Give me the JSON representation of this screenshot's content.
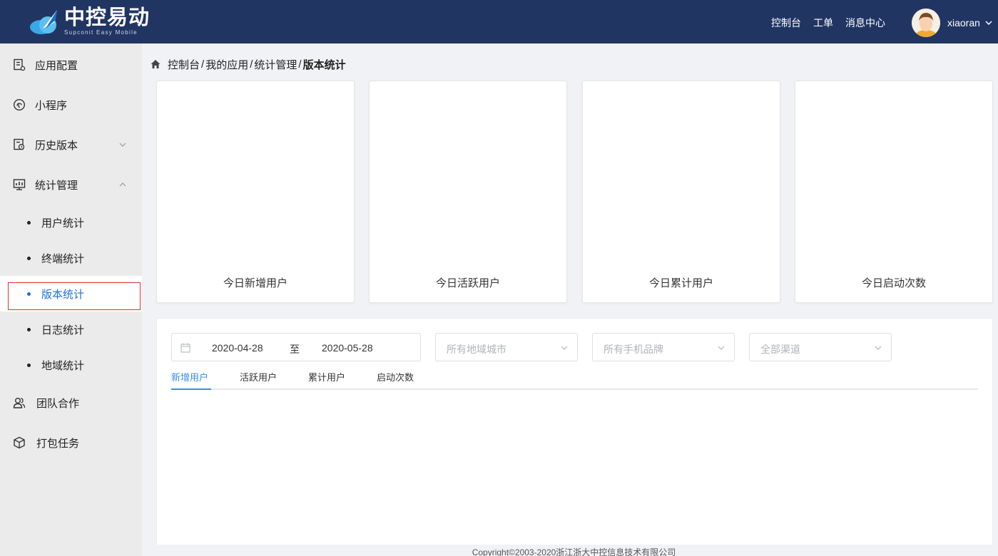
{
  "header": {
    "brand_title": "中控易动",
    "brand_subtitle": "Supconit Easy Mobile",
    "nav": [
      "控制台",
      "工单",
      "消息中心"
    ],
    "username": "xiaoran"
  },
  "sidebar": {
    "items": [
      {
        "label": "应用配置",
        "icon": "app-config-icon"
      },
      {
        "label": "小程序",
        "icon": "mini-program-icon"
      },
      {
        "label": "历史版本",
        "icon": "history-icon",
        "arrow": "down"
      },
      {
        "label": "统计管理",
        "icon": "statistics-icon",
        "arrow": "up"
      },
      {
        "label": "团队合作",
        "icon": "team-icon"
      },
      {
        "label": "打包任务",
        "icon": "package-icon"
      }
    ],
    "sub_items": [
      "用户统计",
      "终端统计",
      "版本统计",
      "日志统计",
      "地域统计"
    ],
    "active_sub": "版本统计"
  },
  "breadcrumb": {
    "items": [
      "控制台",
      "我的应用",
      "统计管理"
    ],
    "separator": "/",
    "current": "版本统计"
  },
  "cards": [
    "今日新增用户",
    "今日活跃用户",
    "今日累计用户",
    "今日启动次数"
  ],
  "filters": {
    "start_date": "2020-04-28",
    "to_label": "至",
    "end_date": "2020-05-28",
    "region_placeholder": "所有地域城市",
    "brand_placeholder": "所有手机品牌",
    "channel_placeholder": "全部渠道"
  },
  "tabs": [
    "新增用户",
    "活跃用户",
    "累计用户",
    "启动次数"
  ],
  "active_tab": "新增用户",
  "footer": "Copyright©2003-2020浙江浙大中控信息技术有限公司",
  "colors": {
    "header_bg": "#213563",
    "sidebar_bg": "#ebebeb",
    "accent": "#1e6fd9",
    "tab_active": "#3a8ee6",
    "outline": "#e03030"
  }
}
